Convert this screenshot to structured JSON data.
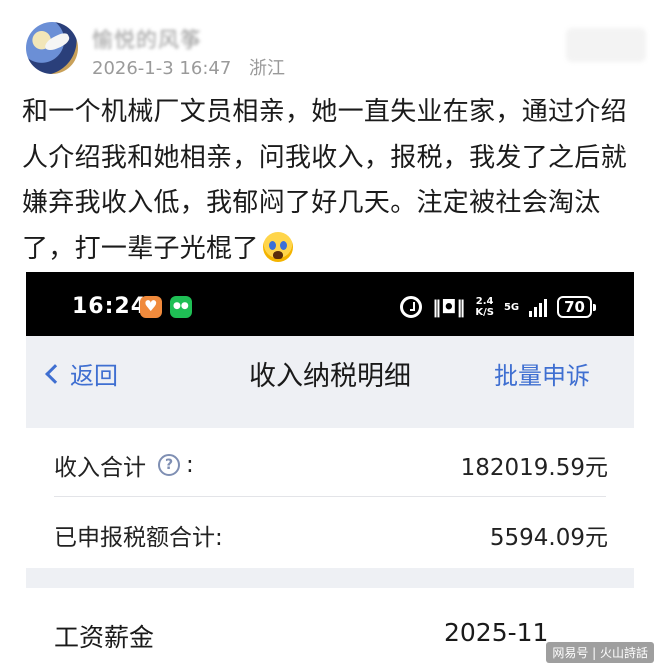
{
  "post": {
    "author": "愉悦的风筝",
    "date": "2026-1-3 16:47",
    "location": "浙江",
    "text": "和一个机械厂文员相亲，她一直失业在家，通过介绍人介绍我和她相亲，问我收入，报税，我发了之后就嫌弃我收入低，我郁闷了好几天。注定被社会淘汰了，打一辈子光棍了",
    "emoji": "crying-face"
  },
  "phone": {
    "status_bar": {
      "time": "16:24",
      "network_speed": "2.4\nK/S",
      "network_type": "5G",
      "battery": "70"
    },
    "nav": {
      "back_label": "返回",
      "title": "收入纳税明细",
      "right_label": "批量申诉"
    },
    "summary": {
      "income_label": "收入合计",
      "income_colon": ":",
      "income_value": "182019.59元",
      "tax_label": "已申报税额合计:",
      "tax_value": "5594.09元"
    },
    "detail": {
      "category": "工资薪金",
      "period": "2025-11"
    }
  },
  "watermark": "网易号 | 火山詩話",
  "colors": {
    "accent_blue": "#3f6fd1",
    "page_bg": "#eef0f4",
    "meta_gray": "#9a9a9a"
  }
}
